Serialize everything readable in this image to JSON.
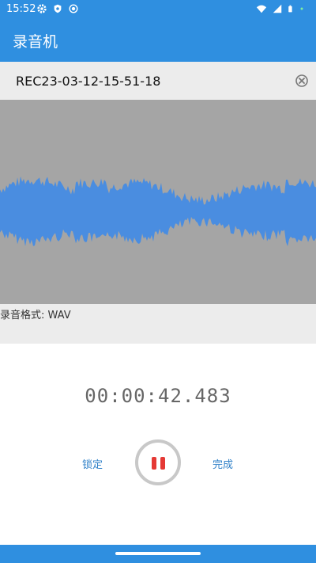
{
  "status_bar": {
    "time": "15:52",
    "left_icons": [
      "gear-icon",
      "shield-icon",
      "record-icon"
    ],
    "right_icons": [
      "wifi-icon",
      "signal-icon",
      "battery-icon",
      "dot-icon"
    ]
  },
  "app_bar": {
    "title": "录音机"
  },
  "recording": {
    "file_name": "REC23-03-12-15-51-18",
    "format_label": "录音格式: WAV",
    "elapsed": "00:00:42.483"
  },
  "controls": {
    "lock_label": "锁定",
    "done_label": "完成",
    "state": "recording"
  },
  "colors": {
    "primary": "#2f8fe0",
    "waveform": "#4a8de0",
    "waveform_bg": "#a5a5a5",
    "pause_icon": "#e53935",
    "link": "#2f80c8"
  }
}
